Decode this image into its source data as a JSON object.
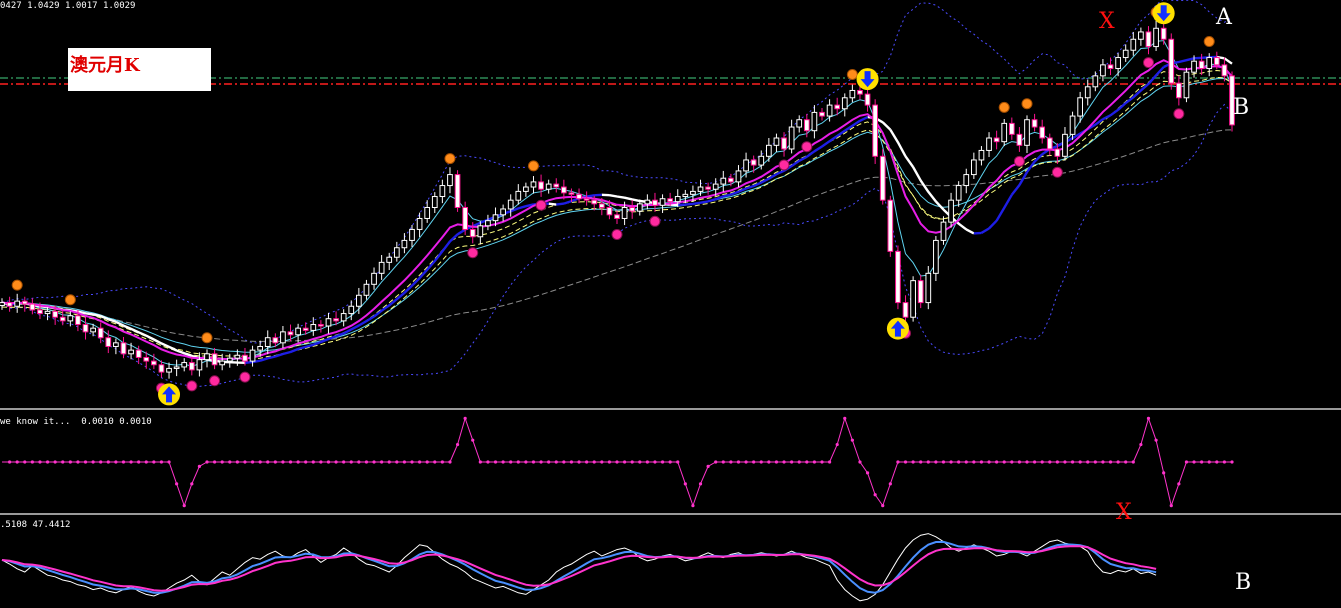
{
  "panels": {
    "main_header": "0427 1.0429 1.0017 1.0029",
    "osc1_header": "we know it...  0.0010 0.0010",
    "osc2_header": ".5108 47.4412"
  },
  "title_box": {
    "text": "澳元月K"
  },
  "annotations": {
    "x_top": "X",
    "a_label": "A",
    "b_label": "B",
    "x_mid": "X",
    "b_bottom": "B"
  },
  "colors": {
    "background": "#000000",
    "bull_candle": "#ffffff",
    "bear_candle": "#ff1493",
    "ma_white": "#ffffff",
    "ma_blue": "#1e1ee6",
    "ma_magenta": "#e81ee8",
    "ma_cyan": "#5fd3f0",
    "ma_yellow_dash": "#ffff80",
    "ma_gray": "#8a8a8a",
    "band_dotted": "#4a4aff",
    "signal_yellow": "#ffe000",
    "signal_arrow": "#1030ff",
    "fractal_orange": "#ff8c1a",
    "fractal_pink": "#ff2aa0",
    "level_red": "#ff2020",
    "level_green": "#2e8b57",
    "osc_magenta": "#ff33cc",
    "osc_blue": "#4a90ff",
    "annot_red": "#ff1010",
    "annot_white": "#ffffff"
  },
  "chart_data": [
    {
      "type": "line",
      "panel": "price",
      "title": "澳元月K",
      "header_values": [
        1.0429,
        1.0017,
        1.0029
      ],
      "levels": [
        {
          "name": "dashed-level-red",
          "color": "#ff2020"
        },
        {
          "name": "dashed-level-green",
          "color": "#2e8b57"
        }
      ],
      "signals": [
        {
          "type": "buy-arrow",
          "bar": 22
        },
        {
          "type": "sell-arrow",
          "bar": 114
        },
        {
          "type": "buy-arrow",
          "bar": 118
        },
        {
          "type": "sell-arrow",
          "bar": 153
        }
      ],
      "candles_close": [
        0.76,
        0.755,
        0.762,
        0.758,
        0.75,
        0.745,
        0.748,
        0.74,
        0.735,
        0.742,
        0.73,
        0.72,
        0.725,
        0.712,
        0.7,
        0.705,
        0.69,
        0.695,
        0.685,
        0.68,
        0.675,
        0.665,
        0.67,
        0.672,
        0.678,
        0.668,
        0.682,
        0.69,
        0.675,
        0.68,
        0.684,
        0.688,
        0.68,
        0.695,
        0.7,
        0.712,
        0.705,
        0.72,
        0.716,
        0.725,
        0.722,
        0.73,
        0.728,
        0.738,
        0.735,
        0.745,
        0.755,
        0.77,
        0.785,
        0.8,
        0.815,
        0.822,
        0.835,
        0.845,
        0.86,
        0.875,
        0.89,
        0.905,
        0.92,
        0.935,
        0.89,
        0.86,
        0.85,
        0.865,
        0.872,
        0.88,
        0.888,
        0.9,
        0.912,
        0.918,
        0.925,
        0.915,
        0.922,
        0.918,
        0.91,
        0.908,
        0.902,
        0.9,
        0.895,
        0.89,
        0.88,
        0.875,
        0.89,
        0.885,
        0.895,
        0.9,
        0.893,
        0.902,
        0.898,
        0.905,
        0.908,
        0.912,
        0.918,
        0.915,
        0.922,
        0.93,
        0.925,
        0.94,
        0.955,
        0.948,
        0.96,
        0.975,
        0.985,
        0.97,
        1.0,
        1.01,
        0.995,
        1.02,
        1.015,
        1.03,
        1.025,
        1.04,
        1.05,
        1.045,
        1.03,
        0.96,
        0.9,
        0.83,
        0.76,
        0.74,
        0.79,
        0.76,
        0.8,
        0.845,
        0.87,
        0.9,
        0.92,
        0.935,
        0.955,
        0.968,
        0.985,
        0.98,
        1.005,
        0.99,
        0.975,
        1.01,
        1.0,
        0.985,
        0.97,
        0.96,
        0.99,
        1.015,
        1.04,
        1.055,
        1.07,
        1.085,
        1.08,
        1.095,
        1.105,
        1.12,
        1.13,
        1.11,
        1.135,
        1.12,
        1.06,
        1.04,
        1.075,
        1.09,
        1.08,
        1.095,
        1.085,
        1.07,
        1.0029
      ]
    },
    {
      "type": "line",
      "panel": "oscillator-1",
      "header_label": "we know it...",
      "header_values": [
        0.001,
        0.001
      ],
      "series": [
        {
          "values": [
            0.001,
            0.001,
            0.001,
            0.001,
            0.001,
            0.001,
            0.001,
            0.001,
            0.001,
            0.001,
            0.001,
            0.001,
            0.001,
            0.001,
            0.001,
            0.001,
            0.001,
            0.001,
            0.001,
            0.001,
            0.001,
            0.001,
            0.001,
            0.0,
            -0.001,
            0.0,
            0.0008,
            0.001,
            0.001,
            0.001,
            0.001,
            0.001,
            0.001,
            0.001,
            0.001,
            0.001,
            0.001,
            0.001,
            0.001,
            0.001,
            0.001,
            0.001,
            0.001,
            0.001,
            0.001,
            0.001,
            0.001,
            0.001,
            0.001,
            0.001,
            0.001,
            0.001,
            0.001,
            0.001,
            0.001,
            0.001,
            0.001,
            0.001,
            0.001,
            0.001,
            0.0018,
            0.003,
            0.002,
            0.001,
            0.001,
            0.001,
            0.001,
            0.001,
            0.001,
            0.001,
            0.001,
            0.001,
            0.001,
            0.001,
            0.001,
            0.001,
            0.001,
            0.001,
            0.001,
            0.001,
            0.001,
            0.001,
            0.001,
            0.001,
            0.001,
            0.001,
            0.001,
            0.001,
            0.001,
            0.001,
            0.0,
            -0.001,
            0.0,
            0.0008,
            0.001,
            0.001,
            0.001,
            0.001,
            0.001,
            0.001,
            0.001,
            0.001,
            0.001,
            0.001,
            0.001,
            0.001,
            0.001,
            0.001,
            0.001,
            0.001,
            0.0018,
            0.003,
            0.002,
            0.001,
            0.0005,
            -0.0005,
            -0.001,
            0.0,
            0.001,
            0.001,
            0.001,
            0.001,
            0.001,
            0.001,
            0.001,
            0.001,
            0.001,
            0.001,
            0.001,
            0.001,
            0.001,
            0.001,
            0.001,
            0.001,
            0.001,
            0.001,
            0.001,
            0.001,
            0.001,
            0.001,
            0.001,
            0.001,
            0.001,
            0.001,
            0.001,
            0.001,
            0.001,
            0.001,
            0.001,
            0.001,
            0.0018,
            0.003,
            0.002,
            0.0005,
            -0.001,
            0.0,
            0.001,
            0.001,
            0.001,
            0.001,
            0.001,
            0.001,
            0.001
          ]
        }
      ]
    },
    {
      "type": "line",
      "panel": "oscillator-2",
      "header_values": [
        0.5108,
        47.4412
      ],
      "series": [
        {
          "values": [
            55,
            50,
            44,
            40,
            48,
            42,
            36,
            34,
            30,
            28,
            24,
            22,
            18,
            20,
            16,
            14,
            18,
            22,
            16,
            12,
            10,
            14,
            20,
            26,
            30,
            36,
            28,
            24,
            32,
            40,
            36,
            44,
            52,
            58,
            56,
            62,
            66,
            60,
            58,
            64,
            68,
            60,
            52,
            58,
            62,
            70,
            64,
            56,
            50,
            48,
            44,
            40,
            48,
            58,
            66,
            74,
            72,
            64,
            56,
            50,
            46,
            40,
            32,
            28,
            24,
            20,
            22,
            18,
            14,
            12,
            18,
            24,
            30,
            40,
            46,
            50,
            56,
            62,
            66,
            60,
            64,
            68,
            70,
            66,
            58,
            54,
            56,
            60,
            62,
            58,
            54,
            56,
            60,
            64,
            60,
            58,
            62,
            64,
            60,
            62,
            64,
            62,
            60,
            62,
            66,
            62,
            58,
            56,
            52,
            48,
            30,
            18,
            10,
            4,
            6,
            12,
            24,
            40,
            56,
            70,
            80,
            86,
            88,
            84,
            78,
            70,
            66,
            70,
            74,
            70,
            66,
            60,
            62,
            66,
            64,
            60,
            66,
            72,
            78,
            80,
            76,
            74,
            72,
            66,
            50,
            40,
            38,
            42,
            40,
            44,
            38,
            40,
            36
          ]
        }
      ]
    }
  ]
}
